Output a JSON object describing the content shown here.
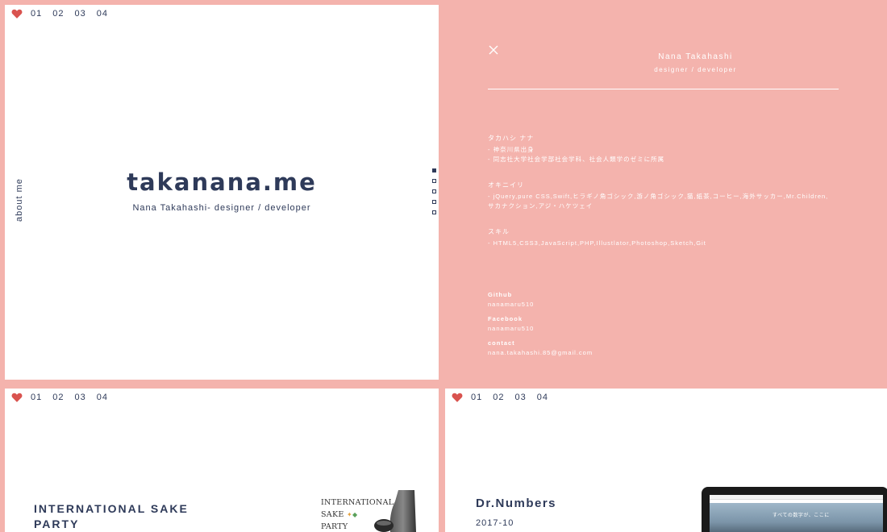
{
  "nav": {
    "items": [
      "01",
      "02",
      "03",
      "04"
    ]
  },
  "home": {
    "title": "takanana.me",
    "subtitle": "Nana Takahashi- designer / developer",
    "about_label": "about me"
  },
  "profile": {
    "name": "Nana Takahashi",
    "role": "designer / developer",
    "sections": [
      {
        "heading": "タカハシ ナナ",
        "lines": [
          "- 神奈川県出身",
          "- 同志社大学社会学部社会学科、社会人類学のゼミに所属"
        ]
      },
      {
        "heading": "オキニイリ",
        "lines": [
          "- jQuery,pure CSS,Swift,ヒラギノ角ゴシック,游ノ角ゴシック,猫,紙茶,コーヒー,海外サッカー,Mr.Children,",
          "サカナクション,アジ・ハケツェイ"
        ]
      },
      {
        "heading": "スキル",
        "lines": [
          "- HTML5,CSS3,JavaScript,PHP,Illustlator,Photoshop,Sketch,Git"
        ]
      }
    ],
    "links": [
      {
        "label": "Github",
        "value": "nanamaru510"
      },
      {
        "label": "Facebook",
        "value": "nanamaru510"
      },
      {
        "label": "contact",
        "value": "nana.takahashi.85@gmail.com"
      }
    ]
  },
  "works": {
    "sake": {
      "title_line1": "INTERNATIONAL SAKE",
      "title_line2": "PARTY",
      "image_text": [
        "INTERNATIONAL",
        "SAKE",
        "PARTY"
      ]
    },
    "drnumbers": {
      "title": "Dr.Numbers",
      "date": "2017-10",
      "screen_text": "すべての数字が、ここに"
    }
  },
  "colors": {
    "pink": "#f4b3ad",
    "navy": "#2e3a59",
    "heart": "#d9534f"
  }
}
